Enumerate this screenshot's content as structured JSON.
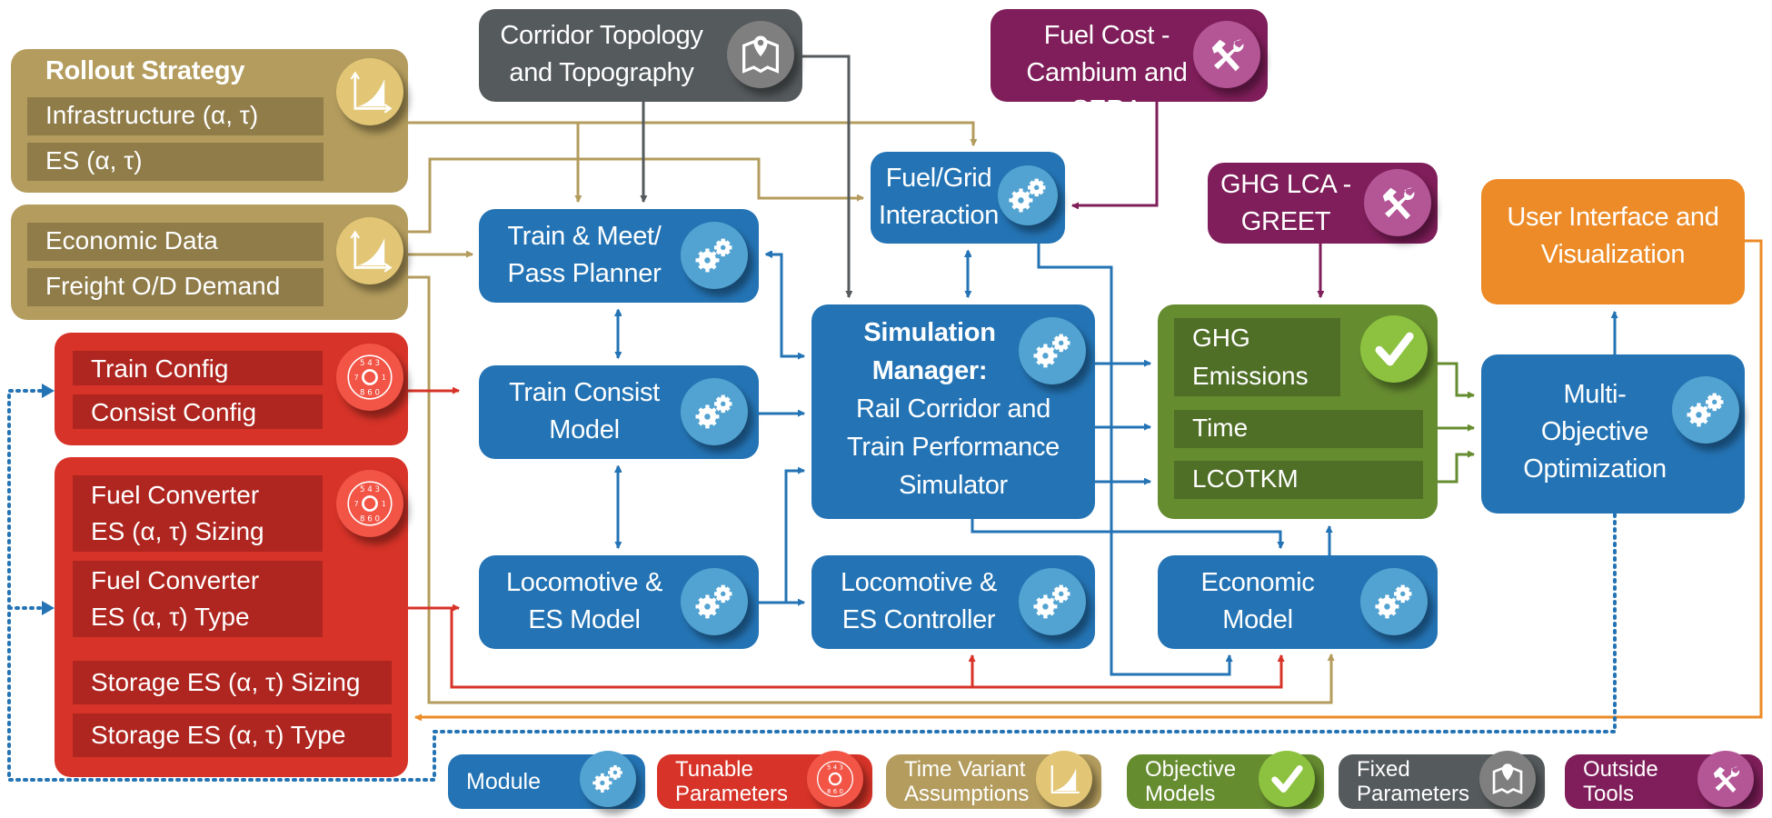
{
  "colors": {
    "module": "#2474b5",
    "tunable": "#d73328",
    "time_variant": "#b39c5d",
    "objective": "#668c30",
    "fixed": "#555a5c",
    "outside": "#7f1e5a",
    "ui": "#ec8b27"
  },
  "inputs": {
    "rollout": {
      "title": "Rollout Strategy",
      "rows": [
        "Infrastructure (α, τ)",
        "ES (α, τ)"
      ],
      "icon": "time-variant-graph-icon"
    },
    "economic_data": {
      "rows": [
        "Economic Data",
        "Freight O/D Demand"
      ],
      "icon": "time-variant-graph-icon"
    },
    "train_config": {
      "rows": [
        "Train Config",
        "Consist Config"
      ],
      "icon": "tunable-dial-icon"
    },
    "fuel_config": {
      "rows": [
        "Fuel Converter",
        "ES (α, τ) Sizing",
        "Fuel Converter",
        "ES (α, τ) Type",
        "Storage ES (α, τ) Sizing",
        "Storage ES (α, τ) Type"
      ],
      "icon": "tunable-dial-icon"
    }
  },
  "fixed": {
    "corridor": {
      "line1": "Corridor Topology",
      "line2": "and Topography",
      "icon": "map-pin-icon"
    }
  },
  "outside_tools": {
    "fuel_cost": {
      "line1": "Fuel Cost -",
      "line2": "Cambium and SERA",
      "icon": "tools-icon"
    },
    "ghg_lca": {
      "line1": "GHG LCA -",
      "line2": "GREET",
      "icon": "tools-icon"
    }
  },
  "modules": {
    "train_meet": {
      "line1": "Train & Meet/",
      "line2": "Pass Planner"
    },
    "train_consist": {
      "line1": "Train Consist",
      "line2": "Model"
    },
    "loco_model": {
      "line1": "Locomotive &",
      "line2": "ES Model"
    },
    "fuel_grid": {
      "line1": "Fuel/Grid",
      "line2": "Interaction"
    },
    "sim_manager": {
      "line1": "Simulation",
      "line2": "Manager:",
      "line3": "Rail Corridor and",
      "line4": "Train Performance",
      "line5": "Simulator"
    },
    "loco_controller": {
      "line1": "Locomotive &",
      "line2": "ES Controller"
    },
    "economic": {
      "line1": "Economic",
      "line2": "Model"
    },
    "multi_objective": {
      "line1": "Multi-",
      "line2": "Objective",
      "line3": "Optimization"
    }
  },
  "objectives": {
    "rows": [
      "GHG",
      "Emissions",
      "Time",
      "LCOTKM"
    ],
    "icon": "checkmark-icon"
  },
  "ui_box": {
    "line1": "User Interface and",
    "line2": "Visualization"
  },
  "legend": [
    {
      "line1": "Module",
      "line2": "",
      "icon": "gears-icon"
    },
    {
      "line1": "Tunable",
      "line2": "Parameters",
      "icon": "tunable-dial-icon"
    },
    {
      "line1": "Time Variant",
      "line2": "Assumptions",
      "icon": "time-variant-graph-icon"
    },
    {
      "line1": "Objective",
      "line2": "Models",
      "icon": "checkmark-icon"
    },
    {
      "line1": "Fixed",
      "line2": "Parameters",
      "icon": "map-pin-icon"
    },
    {
      "line1": "Outside",
      "line2": "Tools",
      "icon": "tools-icon"
    }
  ]
}
